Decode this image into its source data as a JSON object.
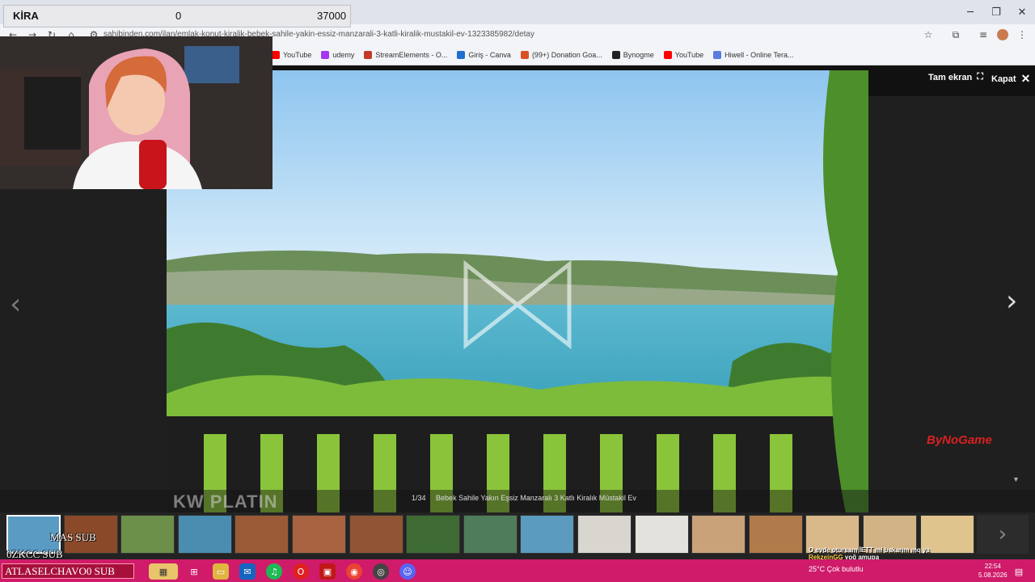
{
  "overlay": {
    "label": "KİRA",
    "min": "0",
    "max": "37000"
  },
  "browser": {
    "url": "sahibinden.com/ilan/emlak-konut-kiralik-bebek-sahile-yakin-essiz-manzarali-3-katli-kiralik-mustakil-ev-1323385982/detay",
    "bookmarks": [
      {
        "label": "YouTube",
        "color": "#ff0000"
      },
      {
        "label": "udemy",
        "color": "#a435f0"
      },
      {
        "label": "StreamElements - O...",
        "color": "#c0392b"
      },
      {
        "label": "Giriş - Canva",
        "color": "#1f6fd1"
      },
      {
        "label": "(99+) Donation Goa...",
        "color": "#d94f26"
      },
      {
        "label": "Bynogme",
        "color": "#222222"
      },
      {
        "label": "YouTube",
        "color": "#ff0000"
      },
      {
        "label": "Hiwell - Online Tera...",
        "color": "#5a7be0"
      }
    ]
  },
  "gallery": {
    "fullscreen_label": "Tam ekran",
    "close_label": "Kapat",
    "counter": "1/34",
    "caption": "Bebek Sahile Yakın Eşsiz Manzaralı 3 Katlı Kiralık Müstakil Ev",
    "watermark": "KW PLATIN",
    "logo": "ByNoGame",
    "thumb_count": 17
  },
  "stream": {
    "sub_line1": "MAS  SUB",
    "sub_line2": "0ZKCC  SUB",
    "sub_banner": "ATLASELCHAVO0  SUB",
    "chat": [
      {
        "user": "",
        "text": "O evde otursam İETT mi bakarım mq ya"
      },
      {
        "user": "RekzeinGG",
        "text": "yoğ amupa"
      },
      {
        "user": "",
        "text": "Kirayı çekip mi giriyorlar bu yazıyı"
      }
    ]
  },
  "taskbar": {
    "weather": "25°C  Çok bulutlu",
    "time": "22:54",
    "date": "5.08.2026"
  },
  "colors": {
    "taskbar": "#cf1b6a",
    "accent": "#d92020"
  }
}
